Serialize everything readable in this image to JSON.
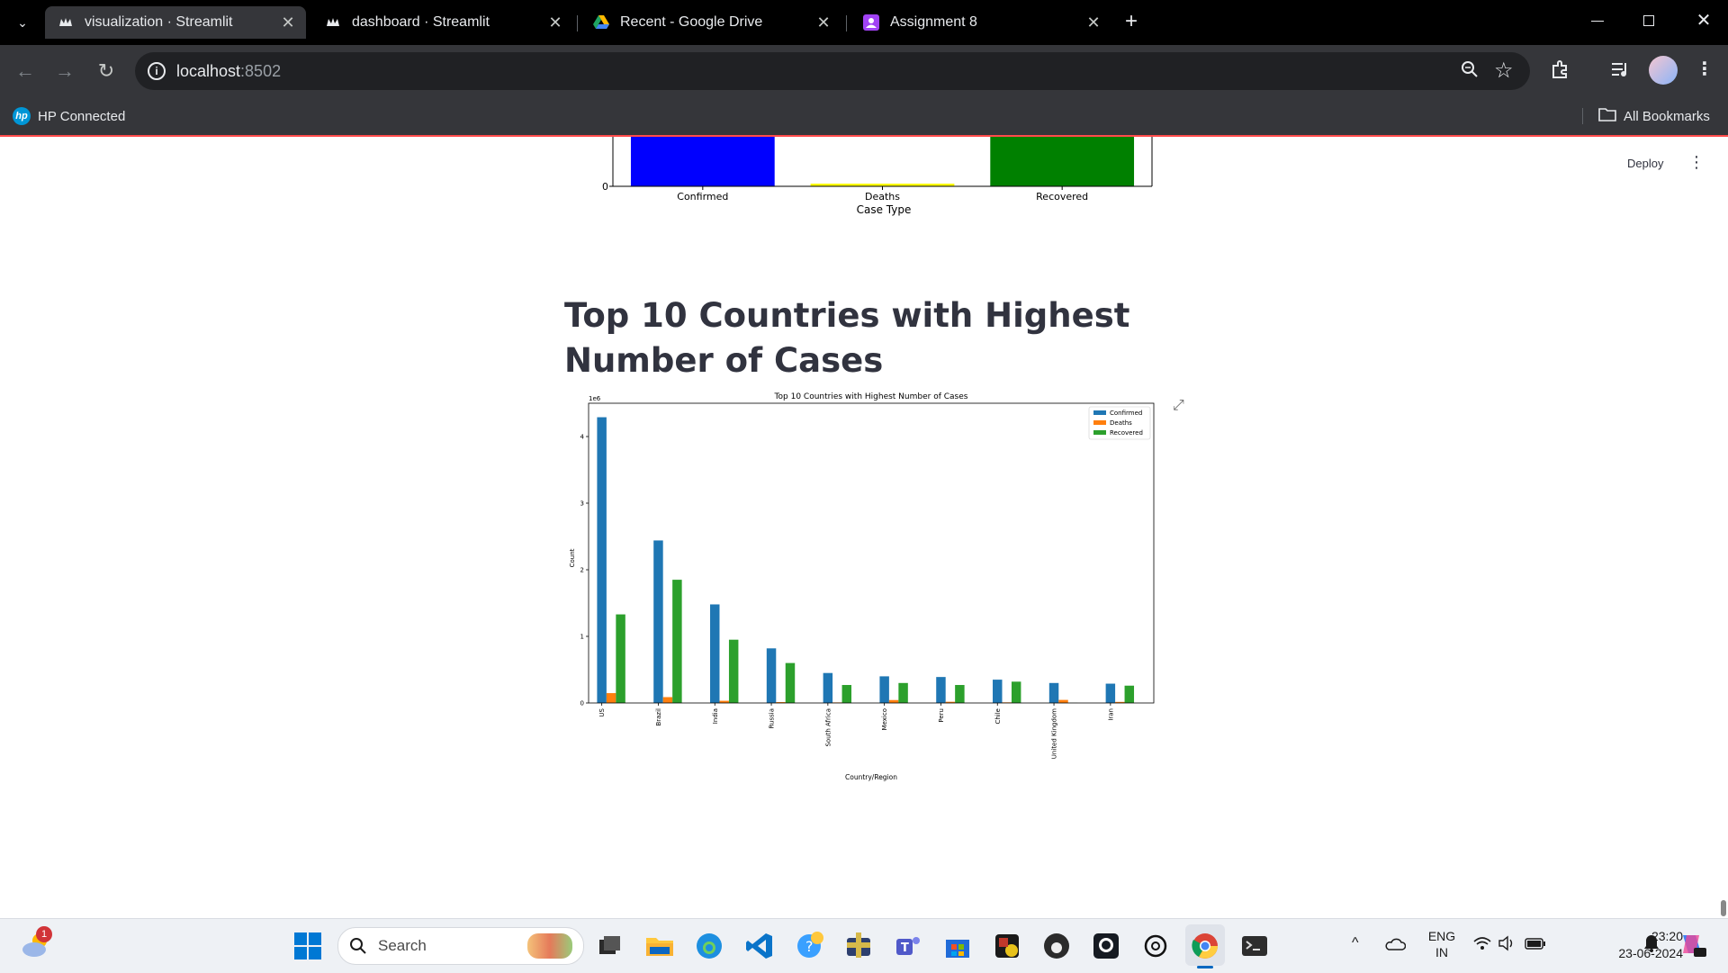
{
  "browser": {
    "tabs": [
      {
        "title": "visualization · Streamlit",
        "active": true,
        "icon": "streamlit-crown-icon"
      },
      {
        "title": "dashboard · Streamlit",
        "active": false,
        "icon": "streamlit-crown-icon"
      },
      {
        "title": "Recent - Google Drive",
        "active": false,
        "icon": "google-drive-icon"
      },
      {
        "title": "Assignment 8",
        "active": false,
        "icon": "classroom-icon"
      }
    ],
    "url_host": "localhost",
    "url_port": ":8502",
    "bookmarks": {
      "left": "HP Connected",
      "right": "All Bookmarks"
    }
  },
  "streamlit": {
    "deploy_label": "Deploy",
    "heading": "Top 10 Countries with Highest Number of Cases"
  },
  "chart_data": [
    {
      "type": "bar",
      "partial": true,
      "categories": [
        "Confirmed",
        "Deaths",
        "Recovered"
      ],
      "colors": [
        "#0000ff",
        "#ffff00",
        "#008000"
      ],
      "xlabel": "Case Type",
      "ytick_visible": "0"
    },
    {
      "type": "bar",
      "title": "Top 10 Countries with Highest Number of Cases",
      "xlabel": "Country/Region",
      "ylabel": "Count",
      "y_multiplier_label": "1e6",
      "ylim": [
        0,
        4.5
      ],
      "yticks": [
        0,
        1,
        2,
        3,
        4
      ],
      "legend_position": "top-right",
      "categories": [
        "US",
        "Brazil",
        "India",
        "Russia",
        "South Africa",
        "Mexico",
        "Peru",
        "Chile",
        "United Kingdom",
        "Iran"
      ],
      "series": [
        {
          "name": "Confirmed",
          "color": "#1f77b4",
          "values": [
            4.29,
            2.44,
            1.48,
            0.82,
            0.45,
            0.4,
            0.39,
            0.35,
            0.3,
            0.29
          ]
        },
        {
          "name": "Deaths",
          "color": "#ff7f0e",
          "values": [
            0.148,
            0.088,
            0.033,
            0.013,
            0.008,
            0.044,
            0.018,
            0.009,
            0.046,
            0.016
          ]
        },
        {
          "name": "Recovered",
          "color": "#2ca02c",
          "values": [
            1.33,
            1.85,
            0.95,
            0.6,
            0.27,
            0.3,
            0.27,
            0.32,
            0.002,
            0.26
          ]
        }
      ]
    }
  ],
  "taskbar": {
    "search_placeholder": "Search",
    "weather_badge": "1",
    "lang_top": "ENG",
    "lang_bottom": "IN",
    "time": "23:20",
    "date": "23-06-2024"
  }
}
